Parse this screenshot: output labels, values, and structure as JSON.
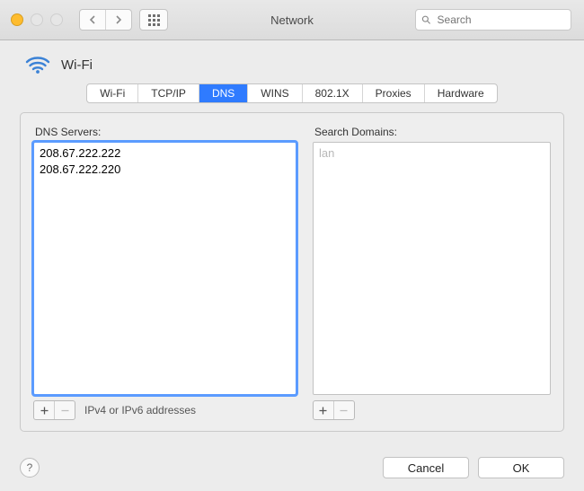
{
  "window": {
    "title": "Network",
    "search_placeholder": "Search"
  },
  "interface": {
    "name": "Wi-Fi"
  },
  "tabs": [
    {
      "label": "Wi-Fi"
    },
    {
      "label": "TCP/IP"
    },
    {
      "label": "DNS"
    },
    {
      "label": "WINS"
    },
    {
      "label": "802.1X"
    },
    {
      "label": "Proxies"
    },
    {
      "label": "Hardware"
    }
  ],
  "active_tab_index": 2,
  "dns": {
    "label": "DNS Servers:",
    "servers": [
      "208.67.222.222",
      "208.67.222.220"
    ],
    "hint": "IPv4 or IPv6 addresses"
  },
  "search_domains": {
    "label": "Search Domains:",
    "items": [],
    "placeholder": "lan"
  },
  "buttons": {
    "cancel": "Cancel",
    "ok": "OK"
  }
}
